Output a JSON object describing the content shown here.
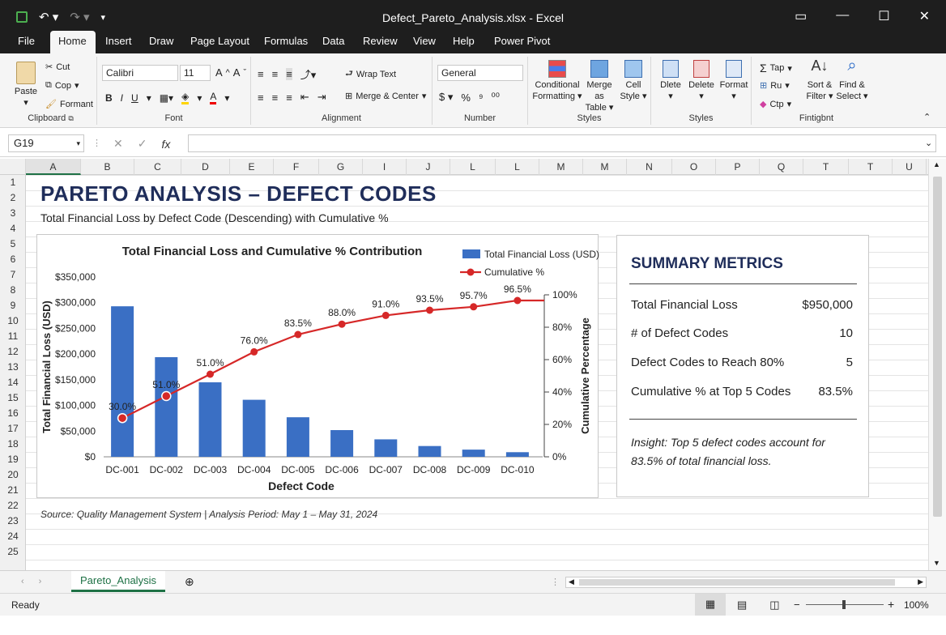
{
  "window": {
    "title": "Defect_Pareto_Analysis.xlsx - Excel"
  },
  "menu": {
    "tabs": [
      "File",
      "Home",
      "Insert",
      "Draw",
      "Page Layout",
      "Formulas",
      "Data",
      "Review",
      "View",
      "Help",
      "Power Pivot"
    ],
    "active": "Home"
  },
  "ribbon": {
    "clipboard": {
      "paste": "Paste",
      "cut": "Cut",
      "copy": "Cop",
      "format": "Formant",
      "label": "Clipboard"
    },
    "font": {
      "name": "Calibri",
      "size": "11",
      "label": "Font"
    },
    "alignment": {
      "wrap": "Wrap Text",
      "merge": "Merge & Center",
      "label": "Alignment"
    },
    "number": {
      "format": "General",
      "label": "Number"
    },
    "styles": {
      "conditional": "Conditional",
      "conditional2": "Formatting",
      "table": "Merge as",
      "table2": "Table",
      "cell": "Cell",
      "cell2": "Style",
      "label": "Styles"
    },
    "cells": {
      "delete1": "Dlete",
      "delete2": "Delete",
      "format": "Format",
      "label": "Styles"
    },
    "editing": {
      "autosum": "Tap",
      "fill": "Ru",
      "clear": "Ctp",
      "sort": "Sort &",
      "sort2": "Filter",
      "find": "Find &",
      "find2": "Select",
      "label": "Fintigbnt"
    }
  },
  "formula": {
    "namebox": "G19",
    "value": ""
  },
  "columns": [
    "A",
    "B",
    "C",
    "D",
    "E",
    "F",
    "G",
    "I",
    "J",
    "L",
    "L",
    "M",
    "M",
    "N",
    "O",
    "P",
    "Q",
    "T",
    "T",
    "U"
  ],
  "rows": [
    "1",
    "2",
    "3",
    "4",
    "5",
    "6",
    "7",
    "8",
    "9",
    "10",
    "11",
    "12",
    "13",
    "14",
    "15",
    "16",
    "17",
    "18",
    "19",
    "20",
    "21",
    "22",
    "23",
    "24",
    "25"
  ],
  "dashboard": {
    "title": "PARETO ANALYSIS – DEFECT CODES",
    "subtitle": "Total Financial Loss by Defect Code (Descending) with Cumulative %",
    "source": "Source: Quality Management System | Analysis Period: May 1 – May 31, 2024"
  },
  "chart_data": {
    "type": "bar",
    "title": "Total Financial Loss and Cumulative % Contribution",
    "xlabel": "Defect Code",
    "ylabel": "Total Financial Loss (USD)",
    "y2label": "Cumulative Percentage",
    "categories": [
      "DC-001",
      "DC-002",
      "DC-003",
      "DC-004",
      "DC-005",
      "DC-006",
      "DC-007",
      "DC-008",
      "DC-009",
      "DC-010"
    ],
    "series": [
      {
        "name": "Total Financial Loss (USD)",
        "type": "bar",
        "color": "#3a6fc4",
        "values": [
          293000,
          194000,
          145000,
          111000,
          77000,
          52000,
          34000,
          21000,
          14000,
          9000
        ]
      },
      {
        "name": "Cumulative %",
        "type": "line",
        "color": "#d62828",
        "axis": "right",
        "values": [
          23.9,
          37.5,
          51.0,
          64.8,
          75.5,
          81.9,
          87.3,
          90.5,
          92.6,
          96.5
        ],
        "labels": [
          "30.0%",
          "51.0%",
          "51.0%",
          "76.0%",
          "83.5%",
          "88.0%",
          "91.0%",
          "93.5%",
          "95.7%",
          "96.5%"
        ]
      }
    ],
    "ylim": [
      0,
      350000
    ],
    "yticks": [
      "$0",
      "$50,000",
      "$100,000",
      "$150,000",
      "$200,000",
      "$250,000",
      "$300,000",
      "$350,000"
    ],
    "y2lim": [
      0,
      100
    ],
    "y2ticks": [
      "0%",
      "20%",
      "40%",
      "60%",
      "80%",
      "100%"
    ],
    "legend": "top-right",
    "grid": false
  },
  "summary": {
    "title": "SUMMARY METRICS",
    "rows": [
      {
        "label": "Total Financial Loss",
        "value": "$950,000"
      },
      {
        "label": "# of Defect Codes",
        "value": "10"
      },
      {
        "label": "Defect Codes to Reach 80%",
        "value": "5"
      },
      {
        "label": "Cumulative % at Top 5 Codes",
        "value": "83.5%"
      }
    ],
    "insight": "Insight: Top 5 defect codes account for 83.5% of total financial loss."
  },
  "sheet": {
    "tab": "Pareto_Analysis"
  },
  "status": {
    "ready": "Ready",
    "zoom": "100%"
  }
}
